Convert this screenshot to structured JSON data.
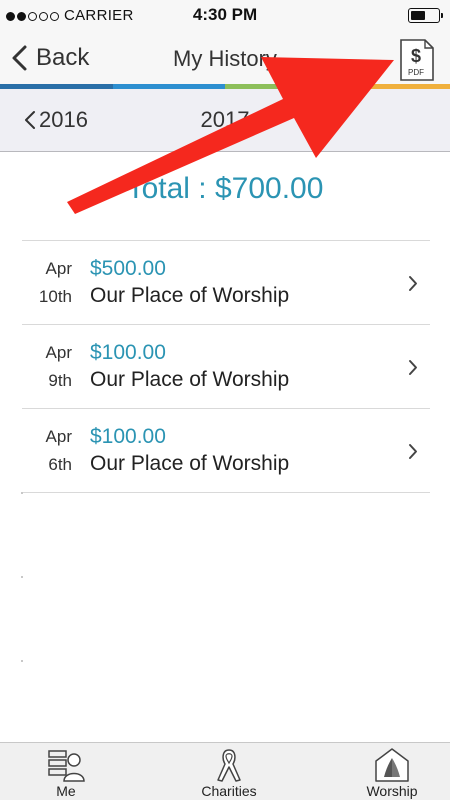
{
  "status_bar": {
    "carrier": "CARRIER",
    "time": "4:30 PM",
    "signal_bars_filled": 2,
    "signal_bars_total": 5,
    "battery_level": 0.55
  },
  "nav": {
    "back_label": "Back",
    "title": "My History",
    "pdf_icon": "pdf-dollar-document-icon",
    "pdf_icon_text": "PDF"
  },
  "stripe_colors": [
    "#2a6fa8",
    "#2d8fd0",
    "#8dbf5a",
    "#f0b03c"
  ],
  "year_selector": {
    "previous_year": "2016",
    "current_year": "2017"
  },
  "total_label": "Total : $700.00",
  "donations": [
    {
      "month": "Apr",
      "day": "10th",
      "amount": "$500.00",
      "place": "Our Place of Worship"
    },
    {
      "month": "Apr",
      "day": "9th",
      "amount": "$100.00",
      "place": "Our Place of Worship"
    },
    {
      "month": "Apr",
      "day": "6th",
      "amount": "$100.00",
      "place": "Our Place of Worship"
    }
  ],
  "tabs": [
    {
      "label": "Me",
      "icon": "person-list-icon"
    },
    {
      "label": "Charities",
      "icon": "awareness-ribbon-icon"
    },
    {
      "label": "Worship",
      "icon": "praying-hands-icon"
    }
  ],
  "colors": {
    "accent": "#2b94b3",
    "annotation_arrow": "#f5281e"
  }
}
